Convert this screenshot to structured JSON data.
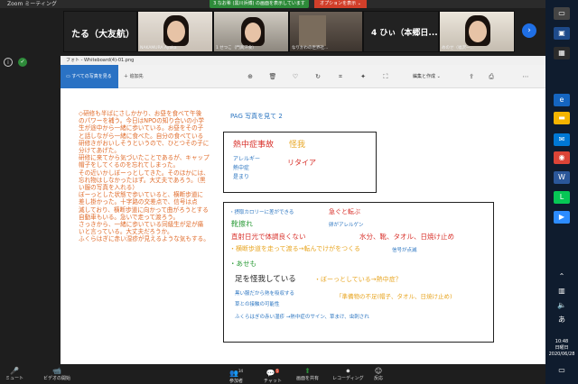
{
  "zoom": {
    "title": "Zoom ミーティング",
    "share_banner": "3 なお希 (黒川浜博) の画面を表示しています",
    "share_options": "オプションを表示 ⌄"
  },
  "strip": {
    "tiles": [
      {
        "name": "たる（大友航）",
        "caption": ""
      },
      {
        "name": "",
        "caption": "NAKAMURA Ayaka"
      },
      {
        "name": "",
        "caption": "1 せつこ（門真汗食）"
      },
      {
        "name": "",
        "caption": "なりかわの世界社..."
      },
      {
        "name": "4 ひぃ（本郷日...",
        "caption": ""
      },
      {
        "name": "",
        "caption": "めのせ（福沢一..."
      }
    ]
  },
  "photo": {
    "title": "フォト - Whiteboard(4)-01.png",
    "all_photos": "すべての写真を見る",
    "add_to": "＋ 追加先",
    "edit_create": "編集と作成 ⌄"
  },
  "whiteboard": {
    "left_note": "◇研修も半ばにさしかかり、お昼を食べて午後\nのパワーを補う。今日はNPOの知り合いの小学\n生が途中から一緒に歩いている。お昼をその子\nと話しながら一緒に食べた。自分の食べている\n研修きがおいしそうというので、ひとつその子に\n分けてあげた。\n研修に来てから気づいたことであるが、キャップ\n帽子をしてくるのを忘れてしまった。\nその近いかしぼーっとしてきた。そのほかには、\n忘れ物はしなかったはず。大丈夫であろう。（黒\nい服の写真を入れる）\nぼーっとした状態で歩いていると、横断歩道に\n差し掛かった。十字路の交差点で、信号は点\n滅しており、横断歩道に向かって曲がろうとする\n自動車もいる。急いで走って渡ろう。\nさっきから、一緒に歩いている同級生が足が痛\nいと言っている。大丈夫だろうか。\nふくらはぎに赤い湿疹が見えるような気もする。",
    "pag": "PAG  写真を見て  2",
    "box1": {
      "heat": "熱中症事故",
      "injury": "怪我",
      "allergy": "アレルギー",
      "heatstroke": "熱中症",
      "fall": "是まり",
      "retire": "リタイア"
    },
    "box2": {
      "calorie": "・摂取カロリーに差ができる",
      "rush": "急ぐと転ぶ",
      "scrape": "靴擦れ",
      "egg": "卵がアレルゲン",
      "sun": "直射日光で体調良くない",
      "items": "水分、靴、タオル、日焼け止め",
      "crosswalk": "・横断歩道を走って渡る→転んでけがをつくる",
      "signal": "信号が点滅",
      "sweat": "・あせも",
      "leg": "足を怪我している",
      "dazed": "・ぼーっとしている→熱中症？",
      "black": "黒い服だから熱を吸収する",
      "lack": "「準備物の不足(帽子、タオル、日焼け止め)",
      "plants": "草との接触の可能性",
      "calf": "ふくらはぎの赤い湿疹 →熱中症のサイン、草まけ、虫刺され"
    }
  },
  "bottom": {
    "mute": "ミュート",
    "video": "ビデオの開始",
    "participants": "参加者",
    "participants_count": "34",
    "chat": "チャット",
    "chat_badge": "5",
    "share": "画面を共有",
    "record": "レコーディング",
    "reactions": "反応"
  },
  "taskbar": {
    "time": "10:48",
    "day": "日曜日",
    "date": "2020/06/28"
  },
  "colors": {
    "zoom_green": "#2e8b3a",
    "zoom_red": "#d23f2a",
    "photo_blue": "#2a72c4"
  }
}
